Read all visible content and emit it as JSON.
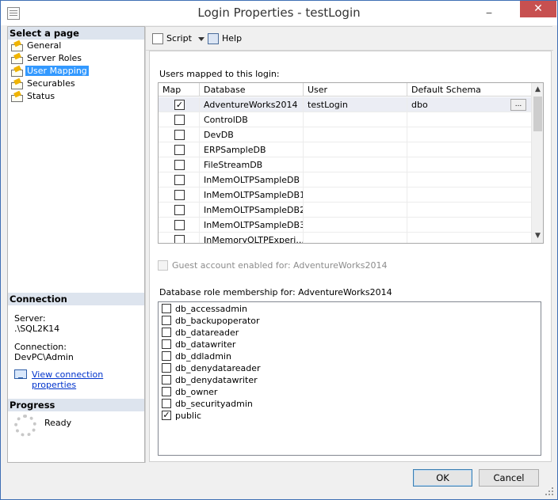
{
  "window": {
    "title": "Login Properties - testLogin",
    "minimize_glyph": "_",
    "close_glyph": "✕"
  },
  "left_pane": {
    "select_page_header": "Select a page",
    "pages": [
      {
        "label": "General",
        "selected": false
      },
      {
        "label": "Server Roles",
        "selected": false
      },
      {
        "label": "User Mapping",
        "selected": true
      },
      {
        "label": "Securables",
        "selected": false
      },
      {
        "label": "Status",
        "selected": false
      }
    ],
    "connection_header": "Connection",
    "server_label": "Server:",
    "server_value": ".\\SQL2K14",
    "connection_label": "Connection:",
    "connection_value": "DevPC\\Admin",
    "view_link": "View connection properties",
    "progress_header": "Progress",
    "progress_status": "Ready"
  },
  "toolbar": {
    "script_label": "Script",
    "help_label": "Help"
  },
  "users_mapped": {
    "label": "Users mapped to this login:",
    "columns": [
      "Map",
      "Database",
      "User",
      "Default Schema"
    ],
    "rows": [
      {
        "map": true,
        "database": "AdventureWorks2014",
        "user": "testLogin",
        "schema": "dbo",
        "ellipsis": "..."
      },
      {
        "map": false,
        "database": "ControlDB",
        "user": "",
        "schema": ""
      },
      {
        "map": false,
        "database": "DevDB",
        "user": "",
        "schema": ""
      },
      {
        "map": false,
        "database": "ERPSampleDB",
        "user": "",
        "schema": ""
      },
      {
        "map": false,
        "database": "FileStreamDB",
        "user": "",
        "schema": ""
      },
      {
        "map": false,
        "database": "InMemOLTPSampleDB",
        "user": "",
        "schema": ""
      },
      {
        "map": false,
        "database": "InMemOLTPSampleDB1",
        "user": "",
        "schema": ""
      },
      {
        "map": false,
        "database": "InMemOLTPSampleDB2",
        "user": "",
        "schema": ""
      },
      {
        "map": false,
        "database": "InMemOLTPSampleDB3",
        "user": "",
        "schema": ""
      },
      {
        "map": false,
        "database": "InMemoryOLTPExperi...",
        "user": "",
        "schema": ""
      }
    ],
    "scroll_up": "▲",
    "scroll_down": "▼"
  },
  "guest_account": {
    "label": "Guest account enabled for: AdventureWorks2014",
    "checked": false
  },
  "role_membership": {
    "label": "Database role membership for: AdventureWorks2014",
    "roles": [
      {
        "name": "db_accessadmin",
        "checked": false
      },
      {
        "name": "db_backupoperator",
        "checked": false
      },
      {
        "name": "db_datareader",
        "checked": false
      },
      {
        "name": "db_datawriter",
        "checked": false
      },
      {
        "name": "db_ddladmin",
        "checked": false
      },
      {
        "name": "db_denydatareader",
        "checked": false
      },
      {
        "name": "db_denydatawriter",
        "checked": false
      },
      {
        "name": "db_owner",
        "checked": false
      },
      {
        "name": "db_securityadmin",
        "checked": false
      },
      {
        "name": "public",
        "checked": true
      }
    ]
  },
  "buttons": {
    "ok": "OK",
    "cancel": "Cancel"
  },
  "colors": {
    "selection": "#3399ff",
    "header_bg": "#dde4ee",
    "close_button": "#c75050",
    "link": "#0033cc"
  }
}
